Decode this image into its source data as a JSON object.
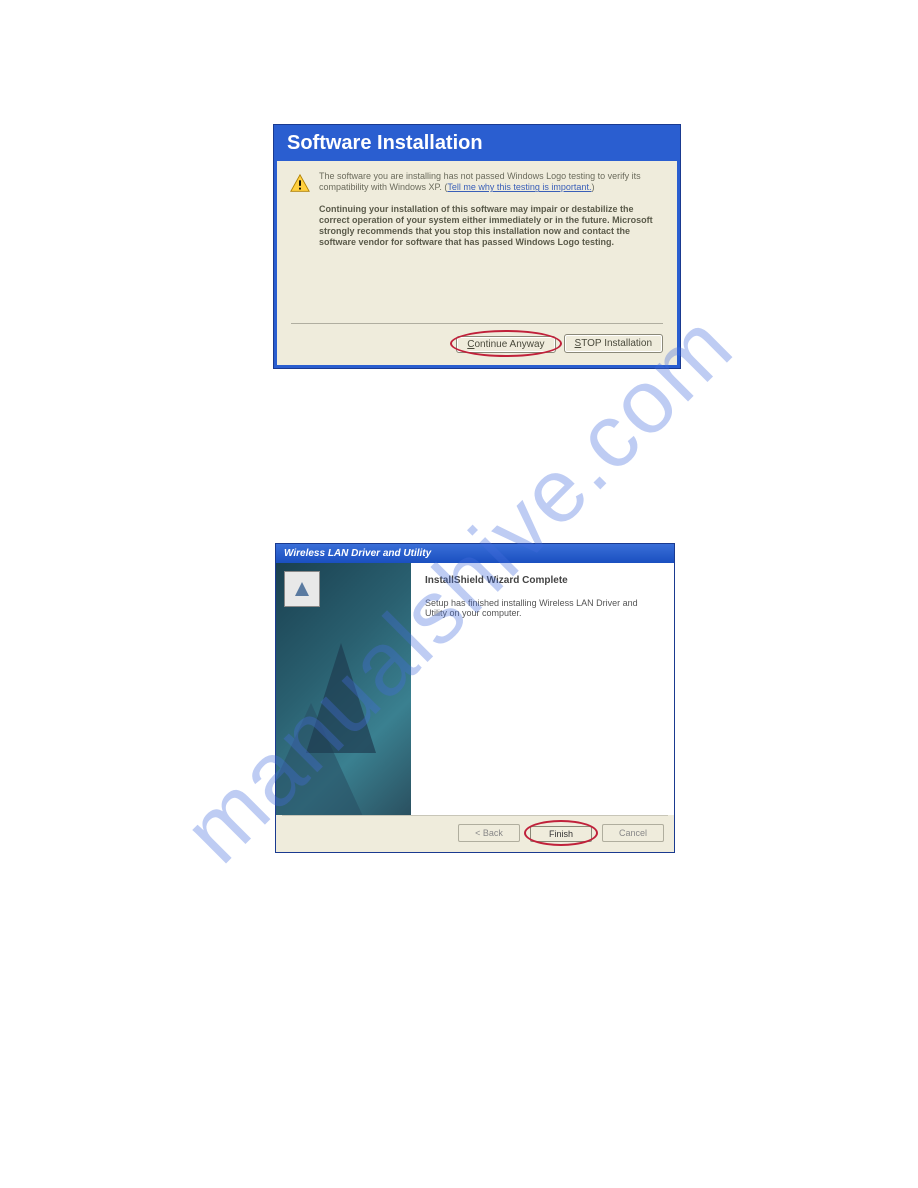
{
  "watermark": "manualshive.com",
  "dialog1": {
    "title": "Software Installation",
    "para1_a": "The software you are installing has not passed Windows Logo testing to verify its compatibility with Windows XP. (",
    "link": "Tell me why this testing is important.",
    "para1_b": ")",
    "para2": "Continuing your installation of this software may impair or destabilize the correct operation of your system either immediately or in the future. Microsoft strongly recommends that you stop this installation now and contact the software vendor for software that has passed Windows Logo testing.",
    "btn_continue_pre": "",
    "btn_continue_u": "C",
    "btn_continue_post": "ontinue Anyway",
    "btn_stop_u": "S",
    "btn_stop_post": "TOP Installation"
  },
  "dialog2": {
    "title": "Wireless LAN Driver and Utility",
    "heading": "InstallShield Wizard Complete",
    "body": "Setup has finished installing  Wireless LAN Driver and Utility on your computer.",
    "btn_back": "< Back",
    "btn_finish": "Finish",
    "btn_cancel": "Cancel"
  }
}
